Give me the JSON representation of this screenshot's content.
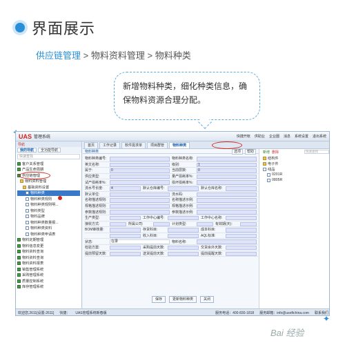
{
  "header": {
    "title": "界面展示"
  },
  "breadcrumb": {
    "a": "供应链管理",
    "sep1": " > ",
    "b": "物料资料管理",
    "sep2": " > ",
    "c": "物料种类"
  },
  "callout": {
    "text": "新增物料种类，细化种类信息，确保物料资源合理分配。"
  },
  "app": {
    "logo": "UAS",
    "system": "管理系统",
    "toolbar": [
      "快捷开帐",
      "供助业",
      "企业圈",
      "消息",
      "系统设置",
      "退出系统"
    ],
    "left_panel": {
      "heading": "导航",
      "tabs": [
        "我的导航",
        "全功能导航"
      ],
      "search_placeholder": "快速查找",
      "tree": [
        {
          "label": "客户关系管理",
          "icon": "pkg"
        },
        {
          "label": "产品生命周期",
          "icon": "pkg"
        },
        {
          "label": "供应链管理",
          "icon": "pkg"
        },
        {
          "label": "物料资料管理",
          "icon": "folder"
        },
        {
          "label": "基础资料设置",
          "icon": "folder"
        },
        {
          "label": "物料种类",
          "icon": "doc",
          "selected": true
        },
        {
          "label": "物料种类规则",
          "icon": "doc"
        },
        {
          "label": "物料种类规则明...",
          "icon": "doc"
        },
        {
          "label": "物料类型",
          "icon": "doc"
        },
        {
          "label": "物料品牌",
          "icon": "doc"
        },
        {
          "label": "物料种类数量报...",
          "icon": "doc"
        },
        {
          "label": "物料种类资料",
          "icon": "doc"
        },
        {
          "label": "物料种类申请表",
          "icon": "doc"
        },
        {
          "label": "物料定期管理",
          "icon": "pkg"
        },
        {
          "label": "物料信息变更",
          "icon": "pkg"
        },
        {
          "label": "物料资料查询",
          "icon": "pkg"
        },
        {
          "label": "物料资料查询",
          "icon": "pkg"
        },
        {
          "label": "物料资料报表",
          "icon": "pkg"
        },
        {
          "label": "销售管理系统",
          "icon": "pkg"
        },
        {
          "label": "采购管理系统",
          "icon": "pkg"
        },
        {
          "label": "质量控制系统",
          "icon": "pkg"
        },
        {
          "label": "库存管理系统",
          "icon": "pkg"
        }
      ]
    },
    "tabs": [
      "首页",
      "工作记录",
      "软件需求单",
      "项目群管",
      "物料种类"
    ],
    "form": {
      "title": "物料种类",
      "btn_options": "选项",
      "btn_help": "帮助",
      "rows": [
        [
          [
            "物料种类编号:",
            ""
          ],
          [
            "物料种类名称:",
            ""
          ]
        ],
        [
          [
            "英文名称:",
            ""
          ],
          [
            "级别:",
            "1"
          ]
        ],
        [
          [
            "属于:",
            "0"
          ],
          [
            "当前层数:",
            "0"
          ]
        ],
        [
          [
            "供应类型:",
            ""
          ],
          [
            "量产损耗率%:",
            ""
          ]
        ],
        [
          [
            "试产损耗率%:",
            ""
          ],
          [
            "损坏损耗率%:",
            ""
          ]
        ],
        [
          [
            "流水号长度:",
            "4"
          ],
          [
            "默认仓库编号:",
            ""
          ],
          [
            "默认仓库名称:",
            ""
          ]
        ],
        [
          [
            "默认单位:",
            ""
          ],
          [
            "流水码:",
            ""
          ]
        ],
        [
          [
            "名称描述规则:",
            ""
          ],
          [
            "名称描述示例:",
            ""
          ]
        ],
        [
          [
            "规格描述规则:",
            ""
          ],
          [
            "规格描述示例:",
            ""
          ]
        ],
        [
          [
            "参数描述规则:",
            ""
          ],
          [
            "参数描述示例:",
            ""
          ]
        ],
        [
          [
            "生产类型:",
            ""
          ],
          [
            "工作中心编号:",
            ""
          ],
          [
            "工作中心名称:",
            ""
          ]
        ],
        [
          [
            "接收方式:",
            ""
          ],
          [
            "所属公司:",
            ""
          ],
          [
            "计划类型:",
            ""
          ],
          [
            "有效期(天):",
            ""
          ]
        ],
        [
          [
            "BOM审核量:",
            ""
          ],
          [
            "存货科目:",
            ""
          ],
          [
            "成本科目:",
            ""
          ]
        ],
        [
          [
            "",
            ""
          ],
          [
            "收入科目:",
            ""
          ],
          [
            "AQL标准:",
            ""
          ]
        ],
        [
          [
            "状态:",
            "在录"
          ],
          [
            "物料名称:",
            ""
          ]
        ],
        [
          [
            "检验方案:",
            ""
          ],
          [
            "采购提前天数:",
            ""
          ],
          [
            "交货余外天数:",
            ""
          ]
        ],
        [
          [
            "提前预留天数:",
            ""
          ],
          [
            "送货提前天数:",
            ""
          ],
          [
            "提前提醒天数:",
            ""
          ]
        ]
      ],
      "actions": [
        "保存",
        "更新物料种类",
        "关闭"
      ]
    },
    "right_panel": {
      "new": "新增",
      "delete": "删除",
      "search_placeholder": "快速查找",
      "items": [
        {
          "label": "结构件",
          "icon": "folder",
          "level": 0
        },
        {
          "label": "电子件",
          "icon": "folder",
          "level": 0
        },
        {
          "label": "线品",
          "icon": "doc",
          "level": 0
        },
        {
          "label": "0201R",
          "icon": "doc",
          "level": 1
        },
        {
          "label": "0805R",
          "icon": "doc",
          "level": 1
        }
      ]
    },
    "status": {
      "user": "欢迎您,2611[设置-2611]",
      "notice": "快捷：",
      "sub": "UAS管理系统新春版",
      "phone": "服务电话：400-830-1818",
      "version": "服务邮箱：info@usoftchina.com",
      "link": "联系我们"
    }
  },
  "watermark": "Bai 经验"
}
